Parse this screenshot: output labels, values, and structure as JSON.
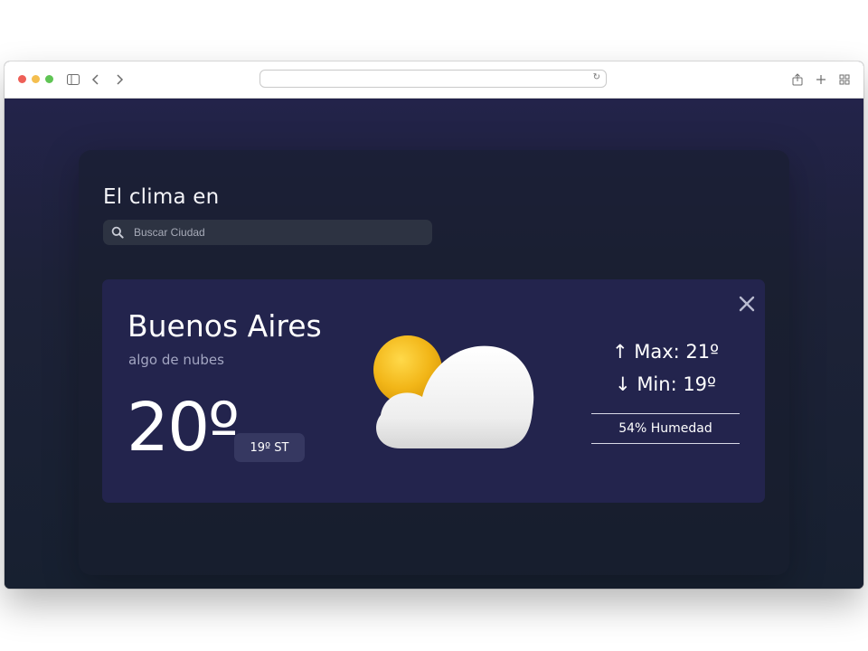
{
  "browser": {
    "url": "",
    "icons": [
      "sidebar-icon",
      "back-icon",
      "forward-icon",
      "reload-icon",
      "share-icon",
      "new-tab-icon",
      "tab-overview-icon"
    ]
  },
  "app": {
    "heading": "El clima en",
    "search": {
      "placeholder": "Buscar Ciudad",
      "value": ""
    }
  },
  "weather": {
    "city": "Buenos Aires",
    "condition": "algo de nubes",
    "temperature": "20º",
    "feels_like": "19º ST",
    "max": "Max: 21º",
    "min": "Min: 19º",
    "humidity": "54% Humedad",
    "icon": "partly-cloudy-icon"
  },
  "colors": {
    "card_background": "#23244d",
    "page_background": "#1d2238",
    "sun": "#f2b618",
    "cloud": "#f1f1f1"
  }
}
